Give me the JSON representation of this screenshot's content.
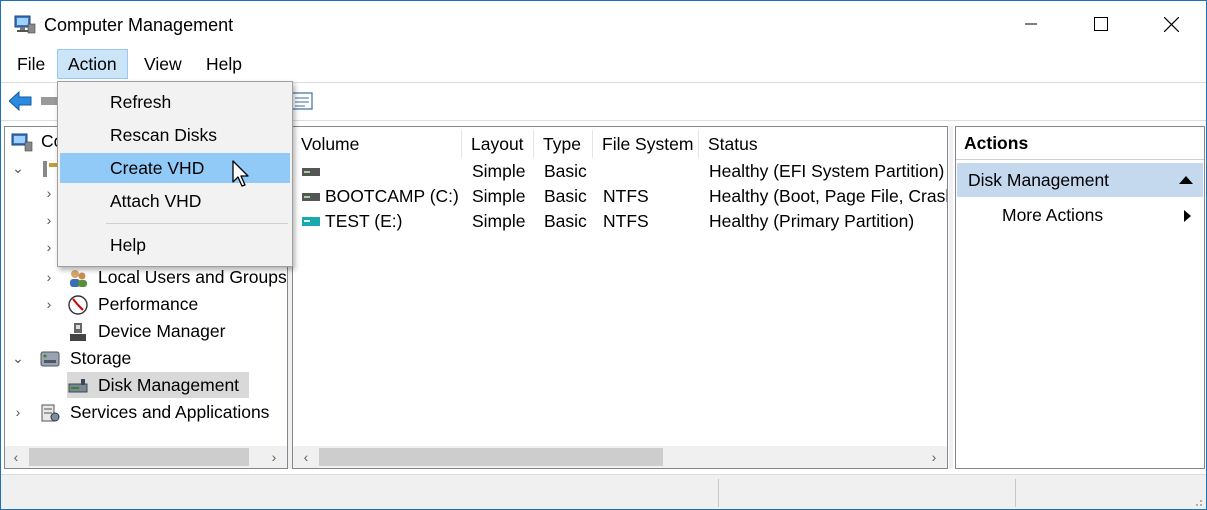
{
  "window": {
    "title": "Computer Management"
  },
  "window_buttons": {
    "minimize": "—",
    "maximize": "☐",
    "close": "✕"
  },
  "menubar": {
    "items": [
      "File",
      "Action",
      "View",
      "Help"
    ]
  },
  "action_menu": {
    "items": [
      "Refresh",
      "Rescan Disks",
      "Create VHD",
      "Attach VHD",
      "Help"
    ],
    "highlighted": "Create VHD"
  },
  "tree": {
    "root_label_partial": "Co",
    "items": [
      {
        "label": "Local Users and Groups",
        "icon": "users-icon"
      },
      {
        "label": "Performance",
        "icon": "performance-icon"
      },
      {
        "label": "Device Manager",
        "icon": "device-manager-icon"
      },
      {
        "label": "Storage",
        "icon": "storage-icon"
      },
      {
        "label": "Disk Management",
        "icon": "disk-icon",
        "selected": true
      },
      {
        "label": "Services and Applications",
        "icon": "services-icon"
      }
    ]
  },
  "volume_list": {
    "columns": [
      "Volume",
      "Layout",
      "Type",
      "File System",
      "Status"
    ],
    "rows": [
      {
        "volume": "",
        "layout": "Simple",
        "type": "Basic",
        "fs": "",
        "status": "Healthy (EFI System Partition)",
        "icon": "drive-icon"
      },
      {
        "volume": "BOOTCAMP (C:)",
        "layout": "Simple",
        "type": "Basic",
        "fs": "NTFS",
        "status": "Healthy (Boot, Page File, Crash",
        "icon": "drive-icon"
      },
      {
        "volume": "TEST (E:)",
        "layout": "Simple",
        "type": "Basic",
        "fs": "NTFS",
        "status": "Healthy (Primary Partition)",
        "icon": "drive-teal-icon"
      }
    ]
  },
  "actions_pane": {
    "header": "Actions",
    "section": "Disk Management",
    "more": "More Actions"
  },
  "colors": {
    "accent_border": "#1a72bb",
    "menu_highlight": "#91c9f7",
    "section_bg": "#c5d9ee"
  }
}
